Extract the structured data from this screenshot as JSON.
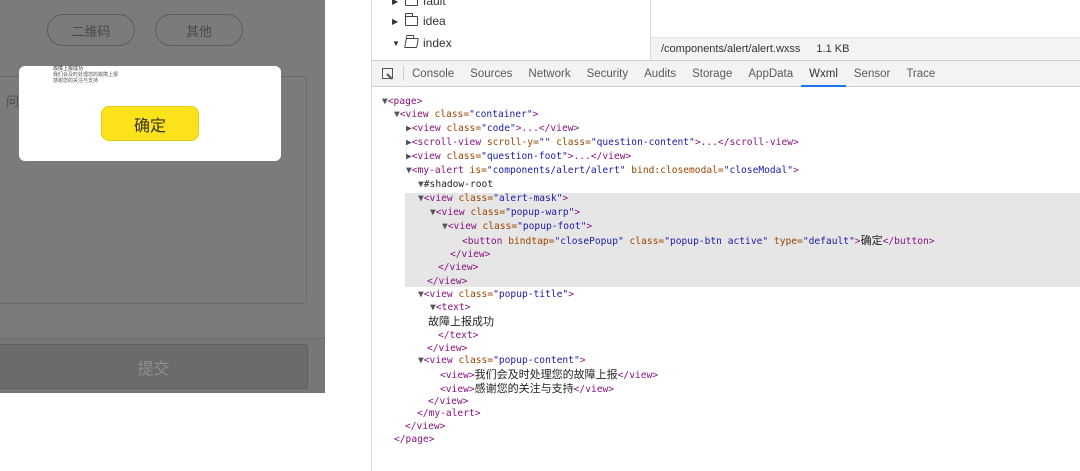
{
  "simulator": {
    "tag_qrcode": "二维码",
    "tag_other": "其他",
    "textarea_prefix": "问",
    "submit_label": "提交",
    "modal": {
      "title": "故障上报成功",
      "line1": "我们会及时处理您的故障上报",
      "line2": "感谢您的关注与支持",
      "confirm_label": "确定"
    }
  },
  "files": {
    "items": [
      {
        "name": "fault",
        "expanded": false
      },
      {
        "name": "idea",
        "expanded": false
      },
      {
        "name": "index",
        "expanded": true
      }
    ],
    "path": "/components/alert/alert.wxss",
    "size": "1.1 KB"
  },
  "devtools": {
    "tabs": [
      "Console",
      "Sources",
      "Network",
      "Security",
      "Audits",
      "Storage",
      "AppData",
      "Wxml",
      "Sensor",
      "Trace"
    ],
    "active_tab": "Wxml",
    "accent_color": "#1a73e8"
  },
  "wxml": {
    "l1": {
      "arrow": "▼",
      "tag": "<page>"
    },
    "l2": {
      "arrow": "▼",
      "open": "<view ",
      "a1": "class=",
      "v1": "\"container\"",
      "close": ">"
    },
    "l3": {
      "arrow": "▶",
      "open": "<view ",
      "a1": "class=",
      "v1": "\"code\"",
      "rest": ">...</view>"
    },
    "l4": {
      "arrow": "▶",
      "open": "<scroll-view ",
      "a1": "scroll-y=",
      "v1": "\"\"",
      "a2": " class=",
      "v2": "\"question-content\"",
      "rest": ">...</scroll-view>"
    },
    "l5": {
      "arrow": "▶",
      "open": "<view ",
      "a1": "class=",
      "v1": "\"question-foot\"",
      "rest": ">...</view>"
    },
    "l6": {
      "arrow": "▼",
      "open": "<my-alert ",
      "a1": "is=",
      "v1": "\"components/alert/alert\"",
      "a2": " bind:closemodal=",
      "v2": "\"closeModal\"",
      "close": ">"
    },
    "l7": {
      "arrow": "▼",
      "text": "#shadow-root"
    },
    "l8": {
      "arrow": "▼",
      "open": "<view ",
      "a1": "class=",
      "v1": "\"alert-mask\"",
      "close": ">"
    },
    "l9": {
      "arrow": "▼",
      "open": "<view ",
      "a1": "class=",
      "v1": "\"popup-warp\"",
      "close": ">"
    },
    "l10": {
      "arrow": "▼",
      "open": "<view ",
      "a1": "class=",
      "v1": "\"popup-foot\"",
      "close": ">"
    },
    "l11": {
      "open": "<button ",
      "a1": "bindtap=",
      "v1": "\"closePopup\"",
      "a2": " class=",
      "v2": "\"popup-btn active\"",
      "a3": " type=",
      "v3": "\"default\"",
      "close": ">",
      "text": "确定",
      "end": "</button>"
    },
    "l12": {
      "tag": "</view>"
    },
    "l13": {
      "tag": "</view>"
    },
    "l14": {
      "tag": "</view>"
    },
    "l15": {
      "arrow": "▼",
      "open": "<view ",
      "a1": "class=",
      "v1": "\"popup-title\"",
      "close": ">"
    },
    "l16": {
      "arrow": "▼",
      "tag": "<text>"
    },
    "l17": {
      "text": "故障上报成功"
    },
    "l18": {
      "tag": "</text>"
    },
    "l19": {
      "tag": "</view>"
    },
    "l20": {
      "arrow": "▼",
      "open": "<view ",
      "a1": "class=",
      "v1": "\"popup-content\"",
      "close": ">"
    },
    "l21": {
      "open": "<view>",
      "text": "我们会及时处理您的故障上报",
      "end": "</view>"
    },
    "l22": {
      "open": "<view>",
      "text": "感谢您的关注与支持",
      "end": "</view>"
    },
    "l23": {
      "tag": "</view>"
    },
    "l24": {
      "tag": "</my-alert>"
    },
    "l25": {
      "tag": "</view>"
    },
    "l26": {
      "tag": "</page>"
    }
  }
}
